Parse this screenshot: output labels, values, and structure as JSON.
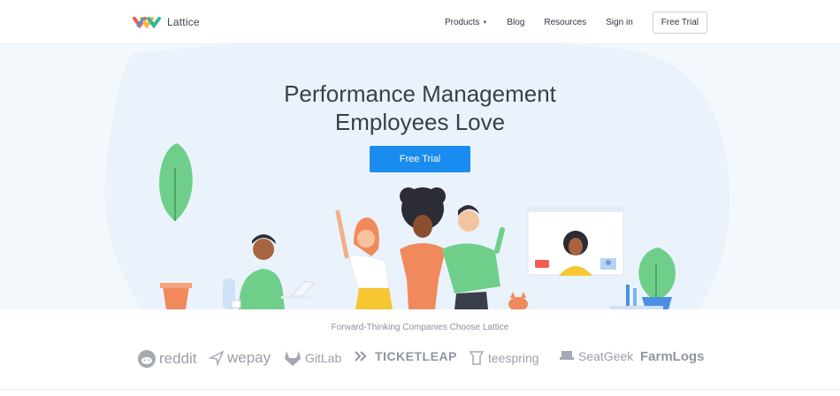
{
  "brand": {
    "name": "Lattice"
  },
  "nav": {
    "products": "Products",
    "blog": "Blog",
    "resources": "Resources",
    "signin": "Sign in",
    "trial": "Free Trial"
  },
  "hero": {
    "title_line1": "Performance Management",
    "title_line2": "Employees Love",
    "cta": "Free Trial"
  },
  "customers": {
    "heading": "Forward-Thinking Companies Choose Lattice",
    "logos": [
      "reddit",
      "wepay",
      "GitLab",
      "TICKETLEAP",
      "teespring",
      "SeatGeek",
      "FarmLogs"
    ]
  },
  "colors": {
    "accent": "#1a8cef",
    "hero_bg": "#f3f8fd",
    "illustration_green": "#6fcf8a",
    "illustration_orange": "#f08a5d"
  }
}
